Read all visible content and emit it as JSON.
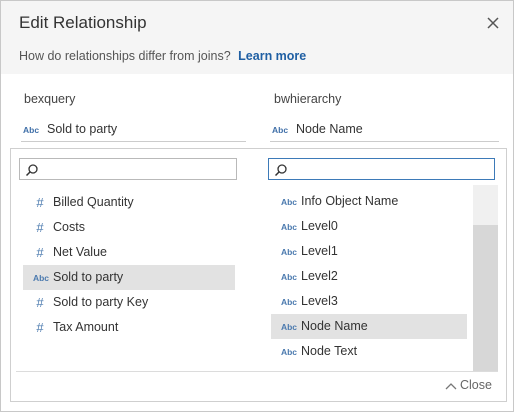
{
  "dialog": {
    "title": "Edit Relationship",
    "subtitle": "How do relationships differ from joins?",
    "learn_more": "Learn more",
    "footer_close": "Close"
  },
  "left": {
    "source": "bexquery",
    "selected_field": {
      "type": "Abc",
      "name": "Sold to party"
    },
    "search_placeholder": "",
    "items": [
      {
        "type": "#",
        "label": "Billed Quantity",
        "selected": false
      },
      {
        "type": "#",
        "label": "Costs",
        "selected": false
      },
      {
        "type": "#",
        "label": "Net Value",
        "selected": false
      },
      {
        "type": "Abc",
        "label": "Sold to party",
        "selected": true
      },
      {
        "type": "#",
        "label": "Sold to party Key",
        "selected": false
      },
      {
        "type": "#",
        "label": "Tax Amount",
        "selected": false
      }
    ]
  },
  "right": {
    "source": "bwhierarchy",
    "selected_field": {
      "type": "Abc",
      "name": "Node Name"
    },
    "search_placeholder": "",
    "items": [
      {
        "type": "Abc",
        "label": "Info Object Name",
        "selected": false
      },
      {
        "type": "Abc",
        "label": "Level0",
        "selected": false
      },
      {
        "type": "Abc",
        "label": "Level1",
        "selected": false
      },
      {
        "type": "Abc",
        "label": "Level2",
        "selected": false
      },
      {
        "type": "Abc",
        "label": "Level3",
        "selected": false
      },
      {
        "type": "Abc",
        "label": "Node Name",
        "selected": true
      },
      {
        "type": "Abc",
        "label": "Node Text",
        "selected": false
      }
    ]
  },
  "colors": {
    "header_bg": "#f5f5f5",
    "link": "#1f5fa3",
    "type_icon": "#3f6fa8",
    "selected_row": "#e2e2e2",
    "focus_border": "#3d7ab8"
  }
}
